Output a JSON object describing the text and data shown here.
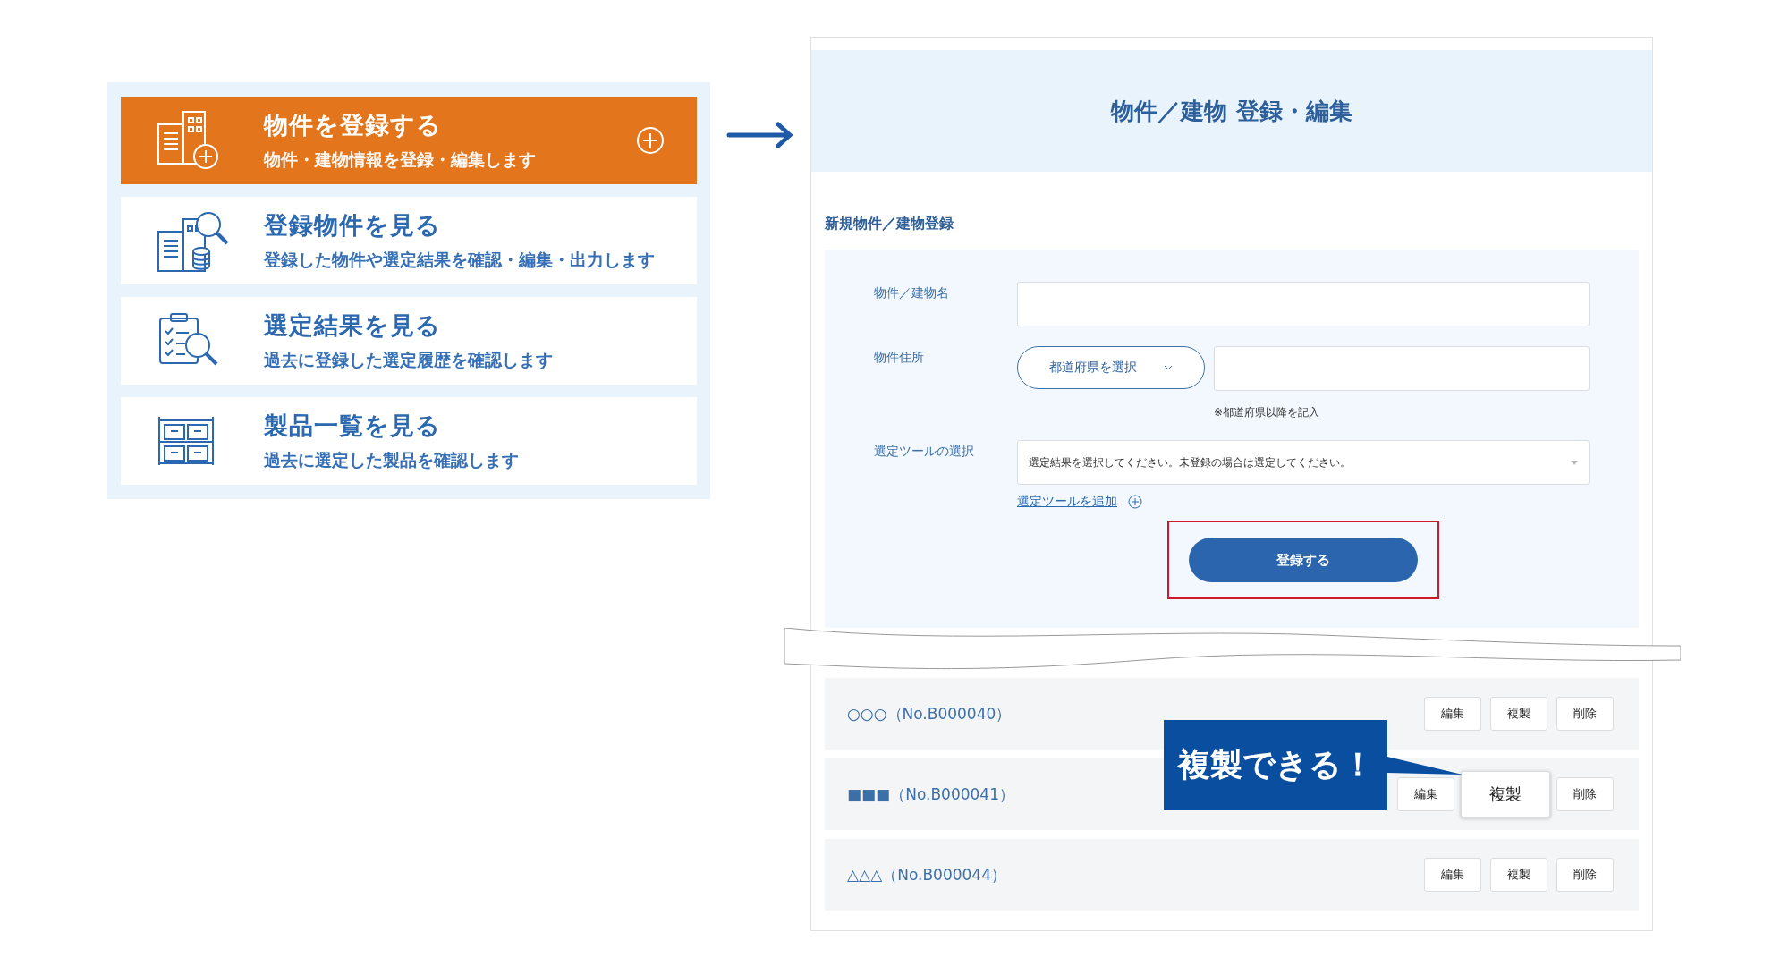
{
  "menu": {
    "items": [
      {
        "kind": "register",
        "title": "物件を登録する",
        "description": "物件・建物情報を登録・編集します",
        "selected": true
      },
      {
        "kind": "properties",
        "title": "登録物件を見る",
        "description": "登録した物件や選定結果を確認・編集・出力します",
        "selected": false
      },
      {
        "kind": "results",
        "title": "選定結果を見る",
        "description": "過去に登録した選定履歴を確認します",
        "selected": false
      },
      {
        "kind": "products",
        "title": "製品一覧を見る",
        "description": "過去に選定した製品を確認します",
        "selected": false
      }
    ]
  },
  "form_page": {
    "header": "物件／建物 登録・編集",
    "section_title": "新規物件／建物登録",
    "fields": [
      {
        "kind": "text",
        "label": "物件／建物名"
      },
      {
        "kind": "address",
        "label": "物件住所",
        "select": "都道府県を選択",
        "note": "※都道府県以降を記入"
      },
      {
        "kind": "select",
        "label": "選定ツールの選択",
        "placeholder": "選定結果を選択してください。未登録の場合は選定してください。"
      }
    ],
    "add_link": "選定ツールを追加",
    "submit": {
      "label": "登録する",
      "highlighted": true
    }
  },
  "list": {
    "rows": [
      {
        "name": "○○○（No.B000040）",
        "buttons": [
          {
            "label": "編集",
            "emphasized": false
          },
          {
            "label": "複製",
            "emphasized": false
          },
          {
            "label": "削除",
            "emphasized": false
          }
        ]
      },
      {
        "name": "■■■（No.B000041）",
        "buttons": [
          {
            "label": "編集",
            "emphasized": false
          },
          {
            "label": "複製",
            "emphasized": true
          },
          {
            "label": "削除",
            "emphasized": false
          }
        ]
      },
      {
        "name": "△△△（No.B000044）",
        "buttons": [
          {
            "label": "編集",
            "emphasized": false
          },
          {
            "label": "複製",
            "emphasized": false
          },
          {
            "label": "削除",
            "emphasized": false
          }
        ]
      }
    ],
    "callout": "複製できる！"
  }
}
